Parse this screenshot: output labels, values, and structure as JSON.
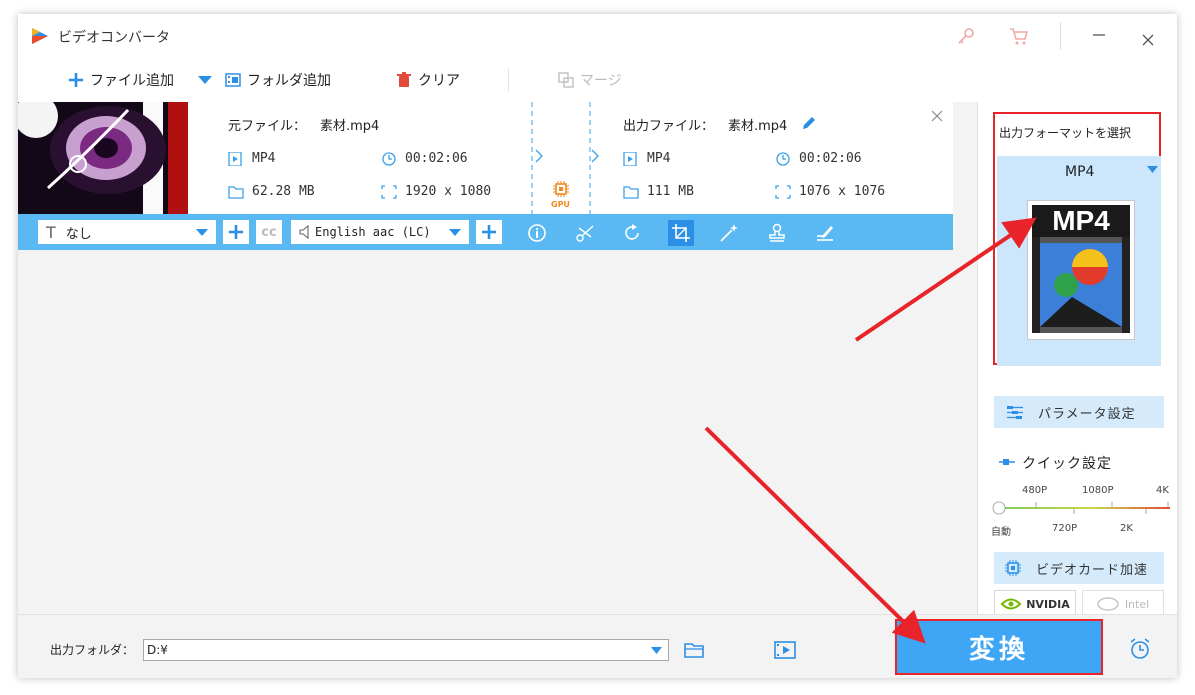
{
  "window": {
    "title": "ビデオコンバータ"
  },
  "toolbar": {
    "add_file": "ファイル追加",
    "add_folder": "フォルダ追加",
    "clear": "クリア",
    "merge": "マージ"
  },
  "task": {
    "source_label": "元ファイル：",
    "source_name": "素材.mp4",
    "source_format": "MP4",
    "source_duration": "00:02:06",
    "source_size": "62.28 MB",
    "source_resolution": "1920 x 1080",
    "gpu_label": "GPU",
    "output_label": "出力ファイル：",
    "output_name": "素材.mp4",
    "output_format": "MP4",
    "output_duration": "00:02:06",
    "output_size": "111 MB",
    "output_resolution": "1076 x 1076"
  },
  "taskbar": {
    "subtitle_value": "なし",
    "audio_value": "English aac (LC)"
  },
  "panel": {
    "format_header": "出力フォーマットを選択",
    "format_value": "MP4",
    "format_icon_text": "MP4",
    "param_button": "パラメータ設定",
    "quick_title": "クイック設定",
    "quality_top": [
      "480P",
      "1080P",
      "4K"
    ],
    "quality_bottom": [
      "自動",
      "720P",
      "2K"
    ],
    "gpu_button": "ビデオカード加速",
    "nvidia": "NVIDIA",
    "intel": "Intel"
  },
  "bottom": {
    "output_folder_label": "出力フォルダ：",
    "output_folder_value": "D:¥",
    "convert_button": "変換"
  },
  "colors": {
    "accent": "#3fa6f5",
    "highlight": "#e8232a",
    "taskbar": "#5ab9f2"
  }
}
